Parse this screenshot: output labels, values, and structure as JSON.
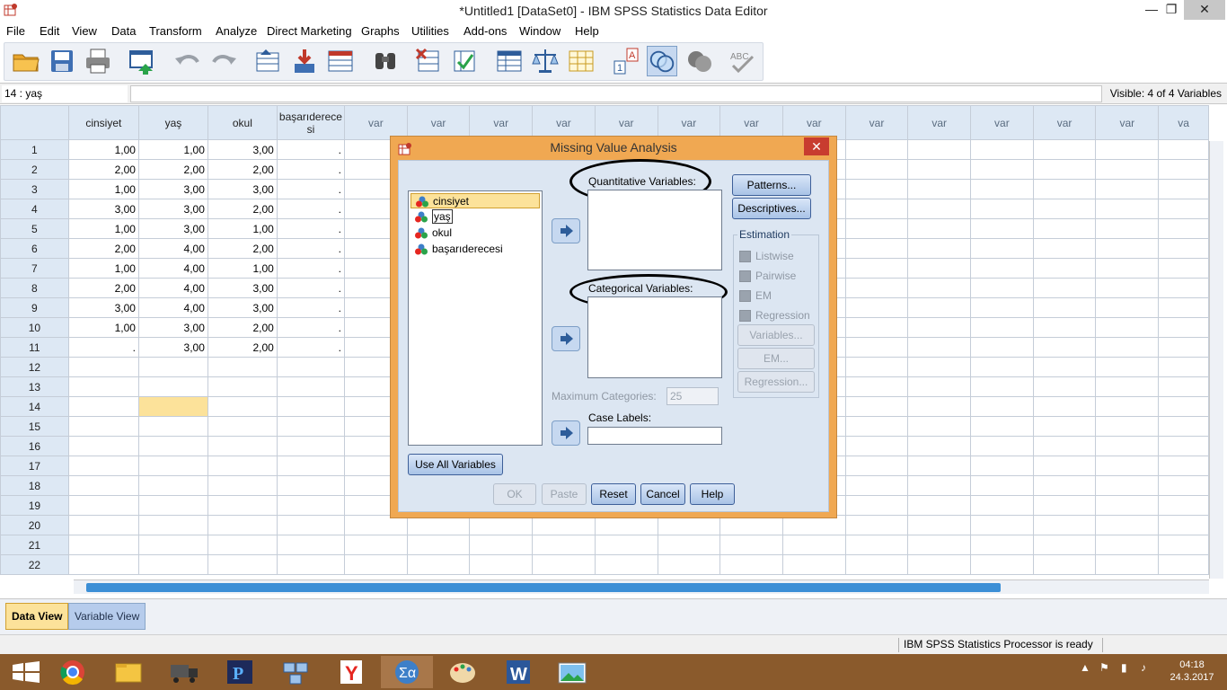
{
  "window": {
    "title": "*Untitled1 [DataSet0] - IBM SPSS Statistics Data Editor",
    "minimize": "—",
    "restore": "❐",
    "close": "✕"
  },
  "menu": [
    "File",
    "Edit",
    "View",
    "Data",
    "Transform",
    "Analyze",
    "Direct Marketing",
    "Graphs",
    "Utilities",
    "Add-ons",
    "Window",
    "Help"
  ],
  "cellbar": {
    "reference": "14 : yaş",
    "value": "",
    "visible": "Visible: 4 of 4 Variables"
  },
  "grid": {
    "headers": [
      "cinsiyet",
      "yaş",
      "okul",
      "başarıderecesi",
      "var",
      "var",
      "var",
      "var",
      "var",
      "var",
      "var",
      "var",
      "var",
      "var",
      "var",
      "var",
      "var",
      "va"
    ],
    "rows": [
      {
        "num": "1",
        "cells": [
          "1,00",
          "1,00",
          "3,00",
          "."
        ]
      },
      {
        "num": "2",
        "cells": [
          "2,00",
          "2,00",
          "2,00",
          "."
        ]
      },
      {
        "num": "3",
        "cells": [
          "1,00",
          "3,00",
          "3,00",
          "."
        ]
      },
      {
        "num": "4",
        "cells": [
          "3,00",
          "3,00",
          "2,00",
          "."
        ]
      },
      {
        "num": "5",
        "cells": [
          "1,00",
          "3,00",
          "1,00",
          "."
        ]
      },
      {
        "num": "6",
        "cells": [
          "2,00",
          "4,00",
          "2,00",
          "."
        ]
      },
      {
        "num": "7",
        "cells": [
          "1,00",
          "4,00",
          "1,00",
          "."
        ]
      },
      {
        "num": "8",
        "cells": [
          "2,00",
          "4,00",
          "3,00",
          "."
        ]
      },
      {
        "num": "9",
        "cells": [
          "3,00",
          "4,00",
          "3,00",
          "."
        ]
      },
      {
        "num": "10",
        "cells": [
          "1,00",
          "3,00",
          "2,00",
          "."
        ]
      },
      {
        "num": "11",
        "cells": [
          ".",
          "3,00",
          "2,00",
          "."
        ]
      },
      {
        "num": "12",
        "cells": [
          "",
          "",
          "",
          ""
        ]
      },
      {
        "num": "13",
        "cells": [
          "",
          "",
          "",
          ""
        ]
      },
      {
        "num": "14",
        "cells": [
          "",
          "",
          "",
          ""
        ]
      },
      {
        "num": "15",
        "cells": [
          "",
          "",
          "",
          ""
        ]
      },
      {
        "num": "16",
        "cells": [
          "",
          "",
          "",
          ""
        ]
      },
      {
        "num": "17",
        "cells": [
          "",
          "",
          "",
          ""
        ]
      },
      {
        "num": "18",
        "cells": [
          "",
          "",
          "",
          ""
        ]
      },
      {
        "num": "19",
        "cells": [
          "",
          "",
          "",
          ""
        ]
      },
      {
        "num": "20",
        "cells": [
          "",
          "",
          "",
          ""
        ]
      },
      {
        "num": "21",
        "cells": [
          "",
          "",
          "",
          ""
        ]
      },
      {
        "num": "22",
        "cells": [
          "",
          "",
          "",
          ""
        ]
      }
    ]
  },
  "tabs": {
    "data_view": "Data View",
    "variable_view": "Variable View"
  },
  "status": {
    "message": "IBM SPSS Statistics Processor is ready"
  },
  "dialog": {
    "title": "Missing Value Analysis",
    "variables": [
      "cinsiyet",
      "yaş",
      "okul",
      "başarıderecesi"
    ],
    "quantitative_label": "Quantitative Variables:",
    "categorical_label": "Categorical Variables:",
    "max_categories_label": "Maximum Categories:",
    "max_categories_value": "25",
    "case_labels_label": "Case Labels:",
    "use_all": "Use All Variables",
    "patterns": "Patterns...",
    "descriptives": "Descriptives...",
    "estimation": {
      "legend": "Estimation",
      "listwise": "Listwise",
      "pairwise": "Pairwise",
      "em": "EM",
      "regression": "Regression",
      "variables_btn": "Variables...",
      "em_btn": "EM...",
      "regression_btn": "Regression..."
    },
    "ok": "OK",
    "paste": "Paste",
    "reset": "Reset",
    "cancel": "Cancel",
    "help": "Help"
  },
  "taskbar": {
    "time": "04:18",
    "date": "24.3.2017"
  },
  "colors": {
    "dialog_frame": "#f0a852",
    "dialog_body": "#dce6f2",
    "selection": "#fce29a",
    "header_bg": "#dde8f4",
    "taskbar": "#8a5a2c",
    "accent_blue": "#3c8fd6"
  }
}
